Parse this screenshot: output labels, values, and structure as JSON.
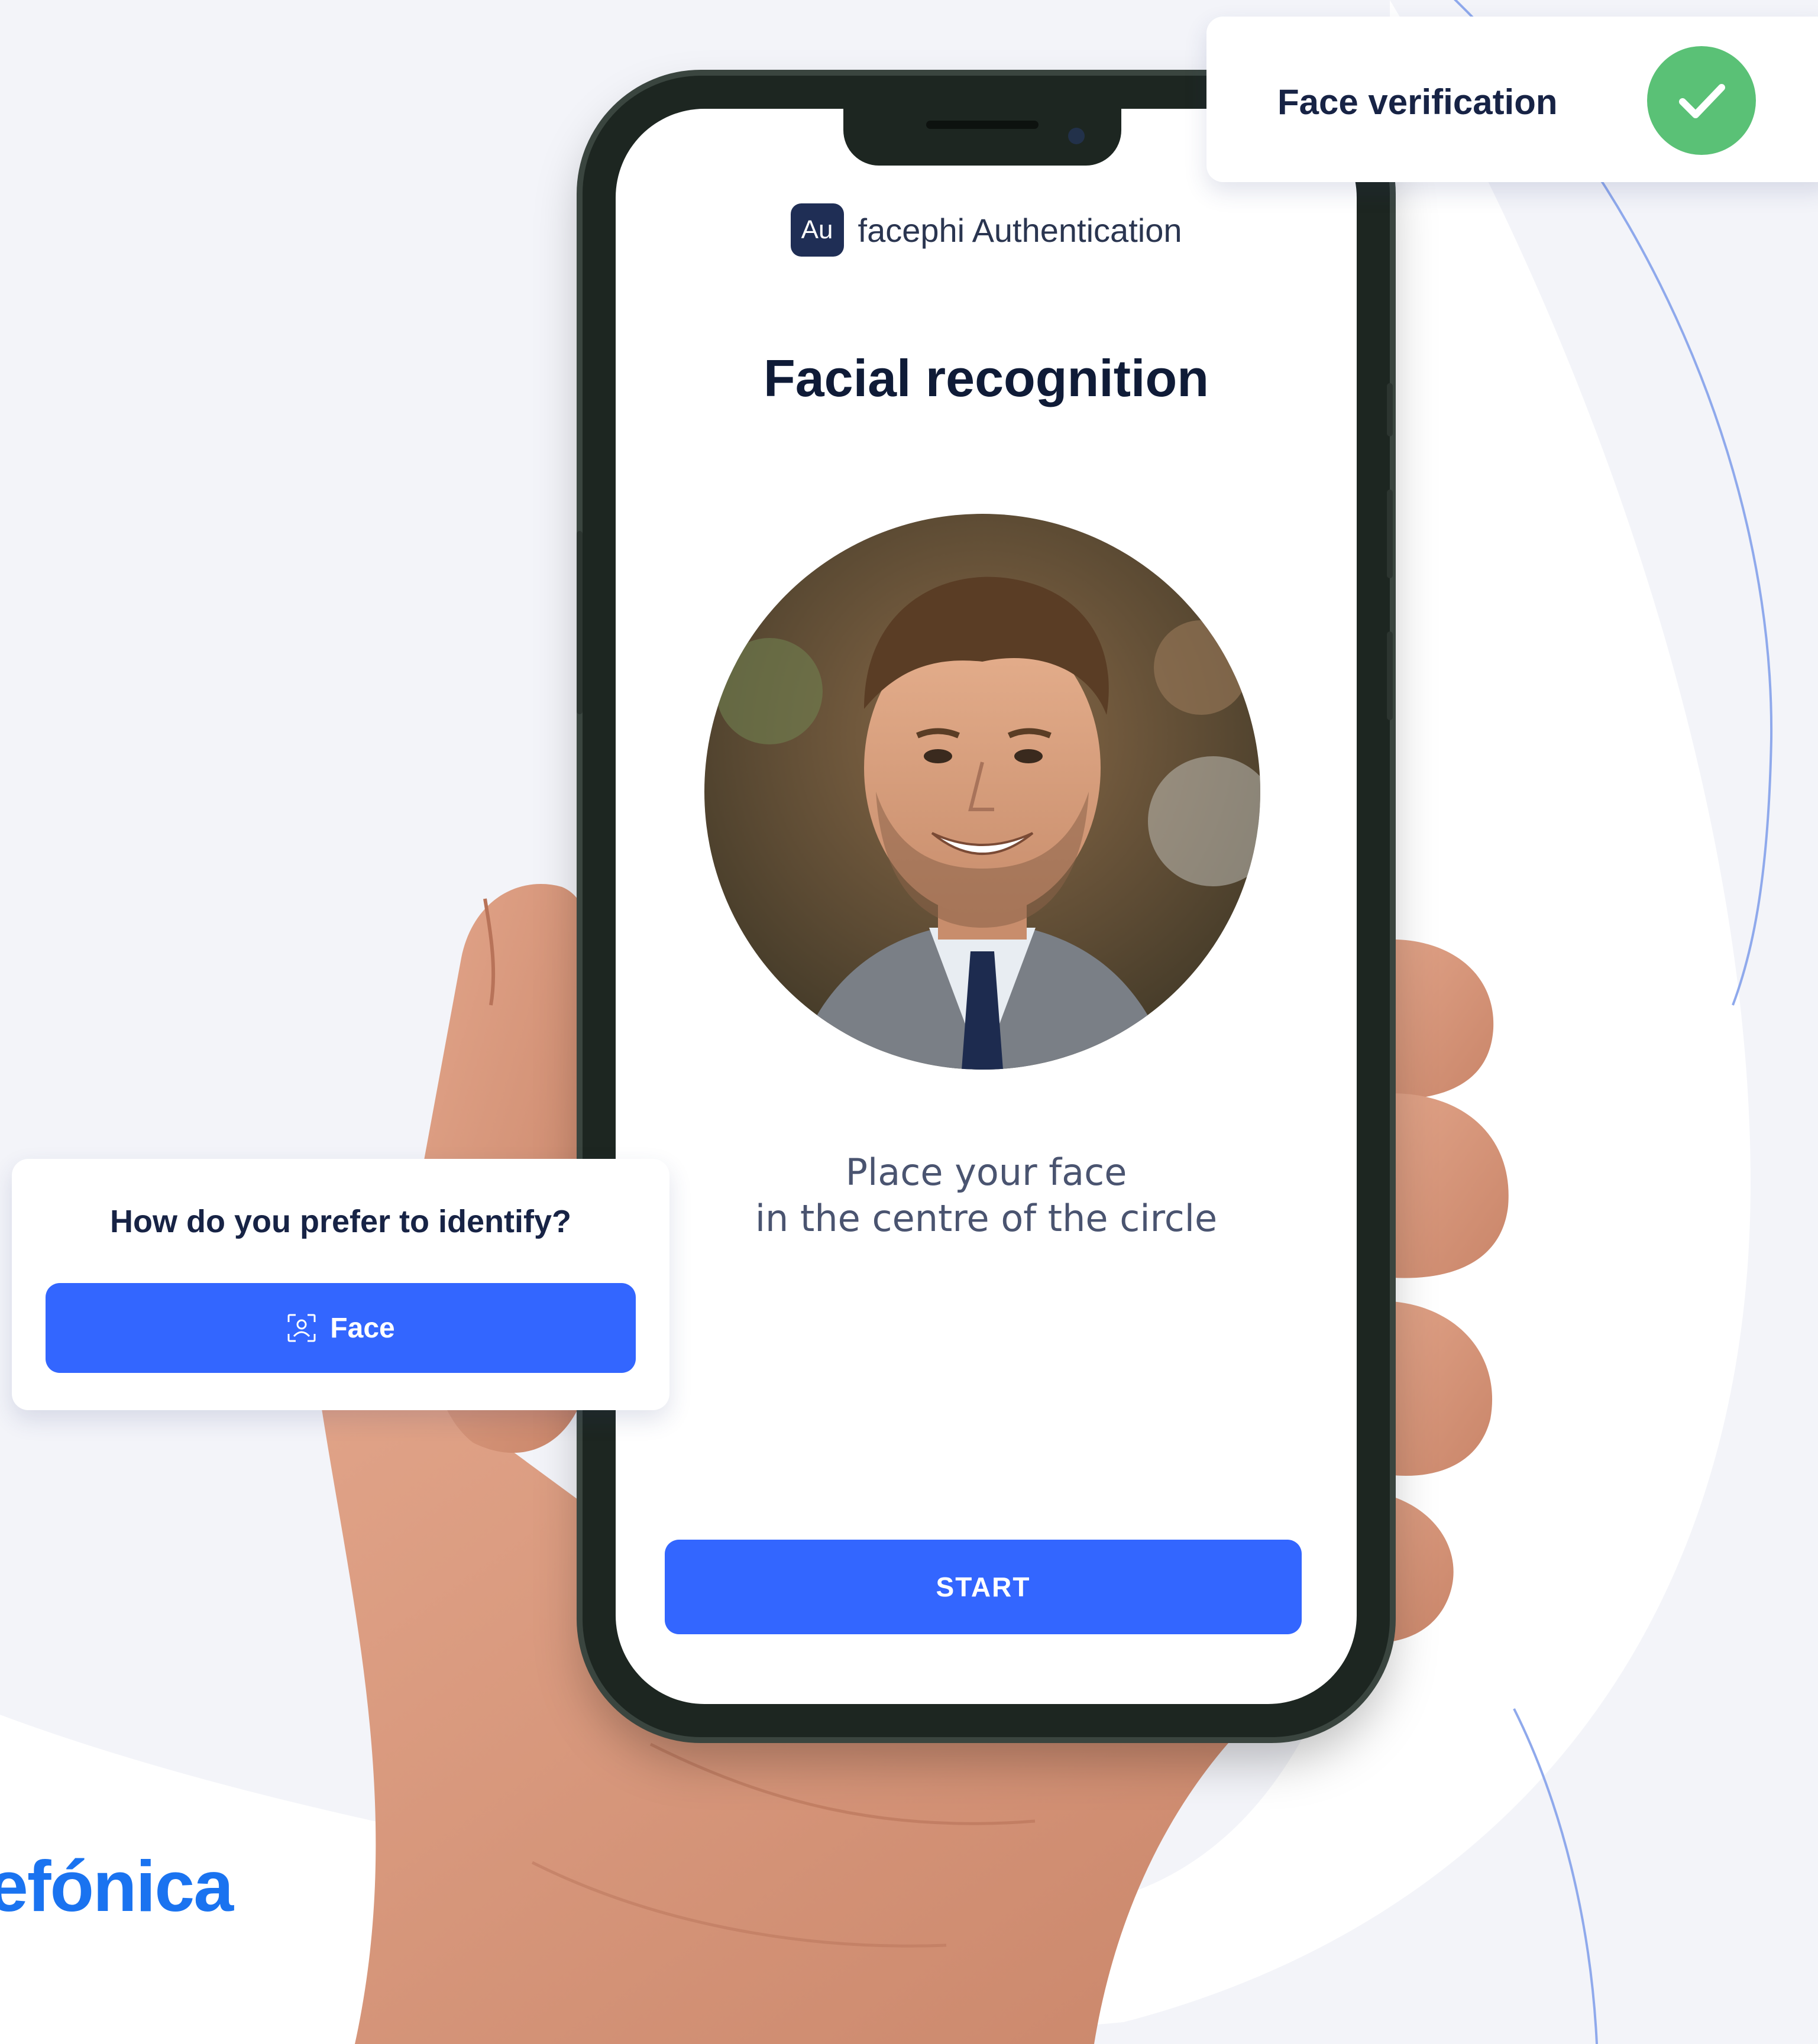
{
  "app": {
    "logo_text": "Au",
    "brand_name": "facephi Authentication",
    "title": "Facial recognition",
    "instruction_line1": "Place your face",
    "instruction_line2": "in the centre of the circle",
    "start_label": "START"
  },
  "verification_card": {
    "label": "Face verification",
    "status_icon": "check-icon",
    "status_color": "#5ac176"
  },
  "identify_card": {
    "question": "How do you prefer to identify?",
    "option_label": "Face",
    "option_icon": "face-scan-icon"
  },
  "corner_brand": {
    "text": "efónica"
  },
  "colors": {
    "accent": "#3366ff",
    "background": "#f3f4f9",
    "title": "#0f1b37",
    "success": "#5ac176",
    "brand_blue": "#1a73f0"
  }
}
